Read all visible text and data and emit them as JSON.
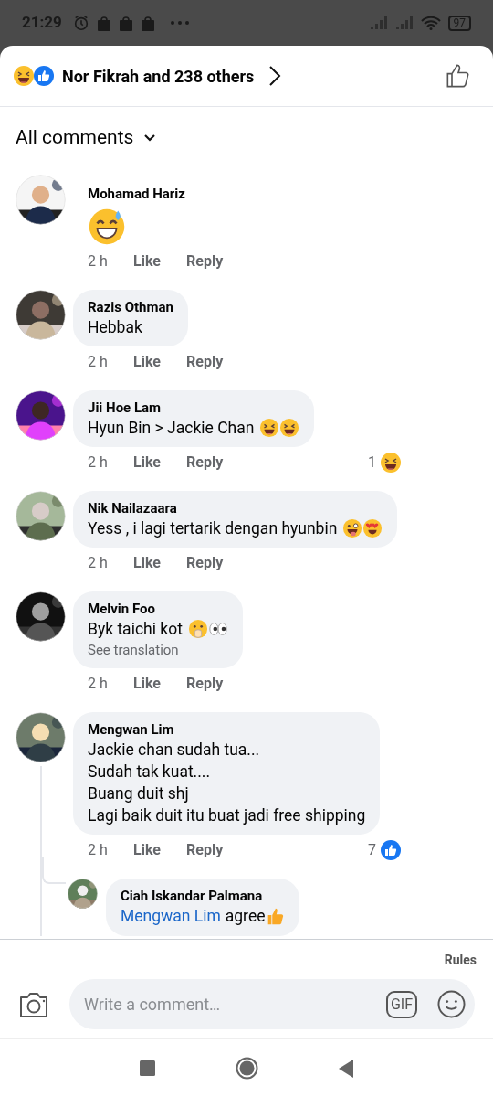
{
  "status_bar": {
    "time": "21:29",
    "battery": "97"
  },
  "reactions": {
    "emojis": [
      {
        "kind": "laughing"
      },
      {
        "kind": "like"
      }
    ],
    "summary": "Nor Fikrah and 238 others"
  },
  "sort": {
    "label": "All comments"
  },
  "comments": [
    {
      "name": "Mohamad Hariz",
      "big_emoji": {
        "kind": "sweat-grin"
      },
      "time": "2 h",
      "like": "Like",
      "reply": "Reply"
    },
    {
      "name": "Razis Othman",
      "lines": [
        "Hebbak"
      ],
      "time": "2 h",
      "like": "Like",
      "reply": "Reply"
    },
    {
      "name": "Jii Hoe Lam",
      "lines": [
        "Hyun Bin > Jackie Chan"
      ],
      "emojis": [
        {
          "kind": "laughing"
        },
        {
          "kind": "laughing"
        }
      ],
      "time": "2 h",
      "like": "Like",
      "reply": "Reply",
      "reaction": {
        "count": "1",
        "kind": "laughing"
      }
    },
    {
      "name": "Nik Nailazaara",
      "lines": [
        "Yess , i lagi tertarik dengan hyunbin"
      ],
      "emojis": [
        {
          "kind": "tongue"
        },
        {
          "kind": "heart-eyes"
        }
      ],
      "time": "2 h",
      "like": "Like",
      "reply": "Reply"
    },
    {
      "name": "Melvin Foo",
      "lines": [
        "Byk taichi kot"
      ],
      "emojis": [
        {
          "kind": "hand-over-mouth"
        },
        {
          "kind": "eyes"
        }
      ],
      "translation": "See translation",
      "time": "2 h",
      "like": "Like",
      "reply": "Reply"
    },
    {
      "name": "Mengwan Lim",
      "lines": [
        "Jackie chan sudah tua...",
        "Sudah tak kuat....",
        "Buang duit shj",
        "Lagi baik duit itu buat jadi free shipping"
      ],
      "time": "2 h",
      "like": "Like",
      "reply": "Reply",
      "reaction": {
        "count": "7",
        "kind": "like"
      },
      "replies": [
        {
          "name": "Ciah Iskandar Palmana",
          "mention": "Mengwan Lim",
          "text": "agree",
          "emojis": [
            {
              "kind": "thumbs-up"
            }
          ]
        }
      ]
    }
  ],
  "rules": "Rules",
  "composer": {
    "placeholder": "Write a comment…",
    "gif": "GIF"
  }
}
